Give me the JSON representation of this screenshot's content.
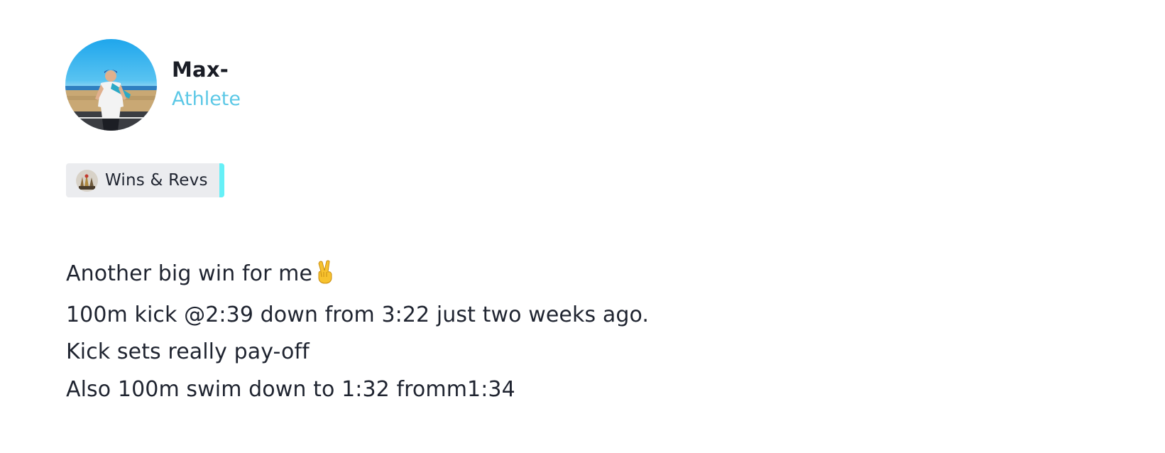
{
  "author": {
    "name": "Max-",
    "role": "Athlete"
  },
  "category": {
    "label": "Wins & Revs",
    "accent_color": "#66f0f7"
  },
  "post": {
    "lines": [
      "Another big win for me",
      "100m kick @2:39 down from 3:22 just two weeks ago.",
      "Kick sets really pay-off",
      "Also 100m swim down to 1:32 fromm1:34"
    ],
    "emoji": "victory-hand"
  },
  "colors": {
    "role_text": "#5cc8e6",
    "body_text": "#1f2430",
    "tag_background": "#ebecef"
  }
}
